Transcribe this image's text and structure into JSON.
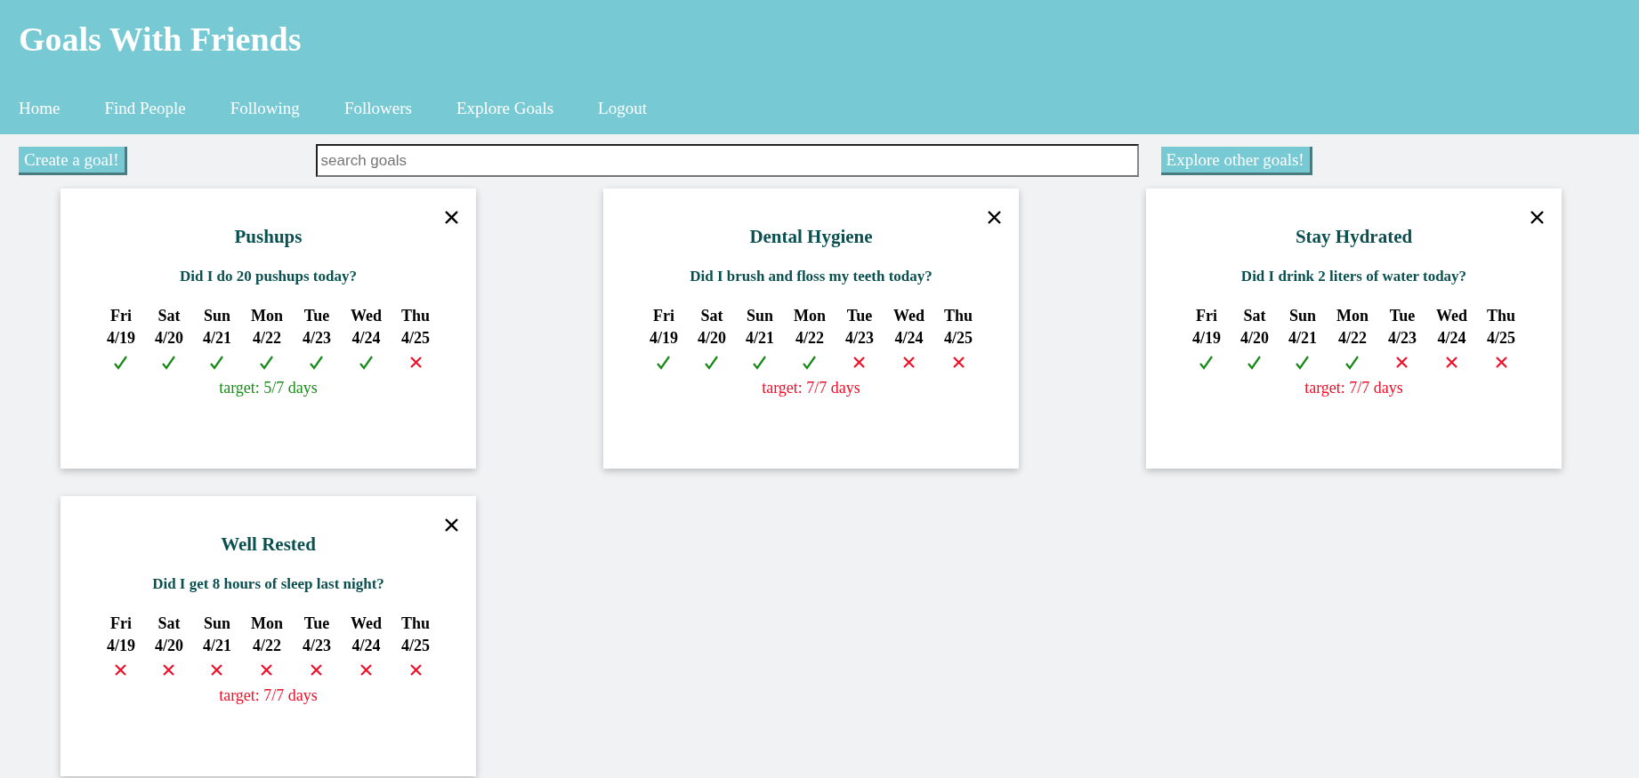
{
  "header": {
    "title": "Goals With Friends",
    "nav": [
      {
        "label": "Home"
      },
      {
        "label": "Find People"
      },
      {
        "label": "Following"
      },
      {
        "label": "Followers"
      },
      {
        "label": "Explore Goals"
      },
      {
        "label": "Logout"
      }
    ]
  },
  "toolbar": {
    "create_button": "Create a goal!",
    "search": {
      "placeholder": "search goals"
    },
    "explore_button": "Explore other goals!"
  },
  "goals": [
    {
      "title": "Pushups",
      "question": "Did I do 20 pushups today?",
      "target": "target: 5/7 days",
      "met": true,
      "days": [
        {
          "day": "Fri",
          "date": "4/19",
          "done": true
        },
        {
          "day": "Sat",
          "date": "4/20",
          "done": true
        },
        {
          "day": "Sun",
          "date": "4/21",
          "done": true
        },
        {
          "day": "Mon",
          "date": "4/22",
          "done": true
        },
        {
          "day": "Tue",
          "date": "4/23",
          "done": true
        },
        {
          "day": "Wed",
          "date": "4/24",
          "done": true
        },
        {
          "day": "Thu",
          "date": "4/25",
          "done": false
        }
      ]
    },
    {
      "title": "Dental Hygiene",
      "question": "Did I brush and floss my teeth today?",
      "target": "target: 7/7 days",
      "met": false,
      "days": [
        {
          "day": "Fri",
          "date": "4/19",
          "done": true
        },
        {
          "day": "Sat",
          "date": "4/20",
          "done": true
        },
        {
          "day": "Sun",
          "date": "4/21",
          "done": true
        },
        {
          "day": "Mon",
          "date": "4/22",
          "done": true
        },
        {
          "day": "Tue",
          "date": "4/23",
          "done": false
        },
        {
          "day": "Wed",
          "date": "4/24",
          "done": false
        },
        {
          "day": "Thu",
          "date": "4/25",
          "done": false
        }
      ]
    },
    {
      "title": "Stay Hydrated",
      "question": "Did I drink 2 liters of water today?",
      "target": "target: 7/7 days",
      "met": false,
      "days": [
        {
          "day": "Fri",
          "date": "4/19",
          "done": true
        },
        {
          "day": "Sat",
          "date": "4/20",
          "done": true
        },
        {
          "day": "Sun",
          "date": "4/21",
          "done": true
        },
        {
          "day": "Mon",
          "date": "4/22",
          "done": true
        },
        {
          "day": "Tue",
          "date": "4/23",
          "done": false
        },
        {
          "day": "Wed",
          "date": "4/24",
          "done": false
        },
        {
          "day": "Thu",
          "date": "4/25",
          "done": false
        }
      ]
    },
    {
      "title": "Well Rested",
      "question": "Did I get 8 hours of sleep last night?",
      "target": "target: 7/7 days",
      "met": false,
      "days": [
        {
          "day": "Fri",
          "date": "4/19",
          "done": false
        },
        {
          "day": "Sat",
          "date": "4/20",
          "done": false
        },
        {
          "day": "Sun",
          "date": "4/21",
          "done": false
        },
        {
          "day": "Mon",
          "date": "4/22",
          "done": false
        },
        {
          "day": "Tue",
          "date": "4/23",
          "done": false
        },
        {
          "day": "Wed",
          "date": "4/24",
          "done": false
        },
        {
          "day": "Thu",
          "date": "4/25",
          "done": false
        }
      ]
    }
  ]
}
